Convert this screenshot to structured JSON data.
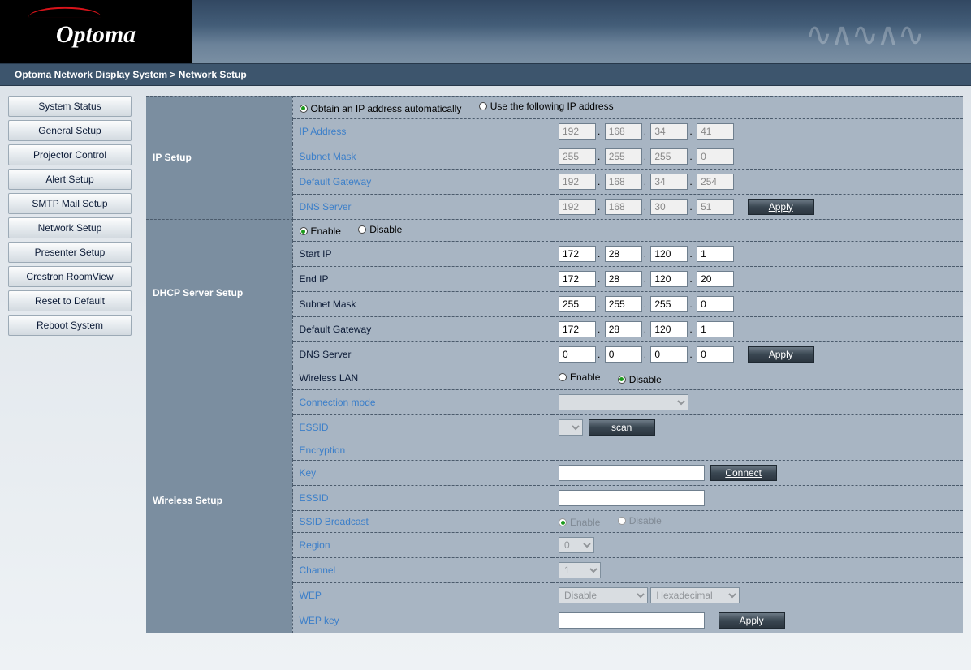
{
  "breadcrumb": "Optoma Network Display System > Network Setup",
  "logo_text": "Optoma",
  "sidebar": {
    "items": [
      {
        "label": "System Status"
      },
      {
        "label": "General Setup"
      },
      {
        "label": "Projector Control"
      },
      {
        "label": "Alert Setup"
      },
      {
        "label": "SMTP Mail Setup"
      },
      {
        "label": "Network Setup"
      },
      {
        "label": "Presenter Setup"
      },
      {
        "label": "Crestron RoomView"
      },
      {
        "label": "Reset to Default"
      },
      {
        "label": "Reboot System"
      }
    ]
  },
  "ip_setup": {
    "section": "IP Setup",
    "auto_label": "Obtain an IP address automatically",
    "manual_label": "Use the following IP address",
    "fields": {
      "ip_address": {
        "label": "IP Address",
        "a": "192",
        "b": "168",
        "c": "34",
        "d": "41"
      },
      "subnet": {
        "label": "Subnet Mask",
        "a": "255",
        "b": "255",
        "c": "255",
        "d": "0"
      },
      "gateway": {
        "label": "Default Gateway",
        "a": "192",
        "b": "168",
        "c": "34",
        "d": "254"
      },
      "dns": {
        "label": "DNS Server",
        "a": "192",
        "b": "168",
        "c": "30",
        "d": "51"
      }
    },
    "apply": "Apply"
  },
  "dhcp": {
    "section": "DHCP Server Setup",
    "enable": "Enable",
    "disable": "Disable",
    "fields": {
      "start": {
        "label": "Start IP",
        "a": "172",
        "b": "28",
        "c": "120",
        "d": "1"
      },
      "end": {
        "label": "End IP",
        "a": "172",
        "b": "28",
        "c": "120",
        "d": "20"
      },
      "subnet": {
        "label": "Subnet Mask",
        "a": "255",
        "b": "255",
        "c": "255",
        "d": "0"
      },
      "gateway": {
        "label": "Default Gateway",
        "a": "172",
        "b": "28",
        "c": "120",
        "d": "1"
      },
      "dns": {
        "label": "DNS Server",
        "a": "0",
        "b": "0",
        "c": "0",
        "d": "0"
      }
    },
    "apply": "Apply"
  },
  "wireless": {
    "section": "Wireless Setup",
    "wlan_label": "Wireless LAN",
    "enable": "Enable",
    "disable": "Disable",
    "conn_mode": "Connection mode",
    "essid": "ESSID",
    "scan": "scan",
    "encryption": "Encryption",
    "key": "Key",
    "connect": "Connect",
    "essid2": "ESSID",
    "ssid_broadcast": "SSID Broadcast",
    "region": "Region",
    "region_val": "0",
    "channel": "Channel",
    "channel_val": "1",
    "wep": "WEP",
    "wep_mode": "Disable",
    "wep_fmt": "Hexadecimal",
    "wep_key": "WEP key",
    "apply": "Apply"
  }
}
